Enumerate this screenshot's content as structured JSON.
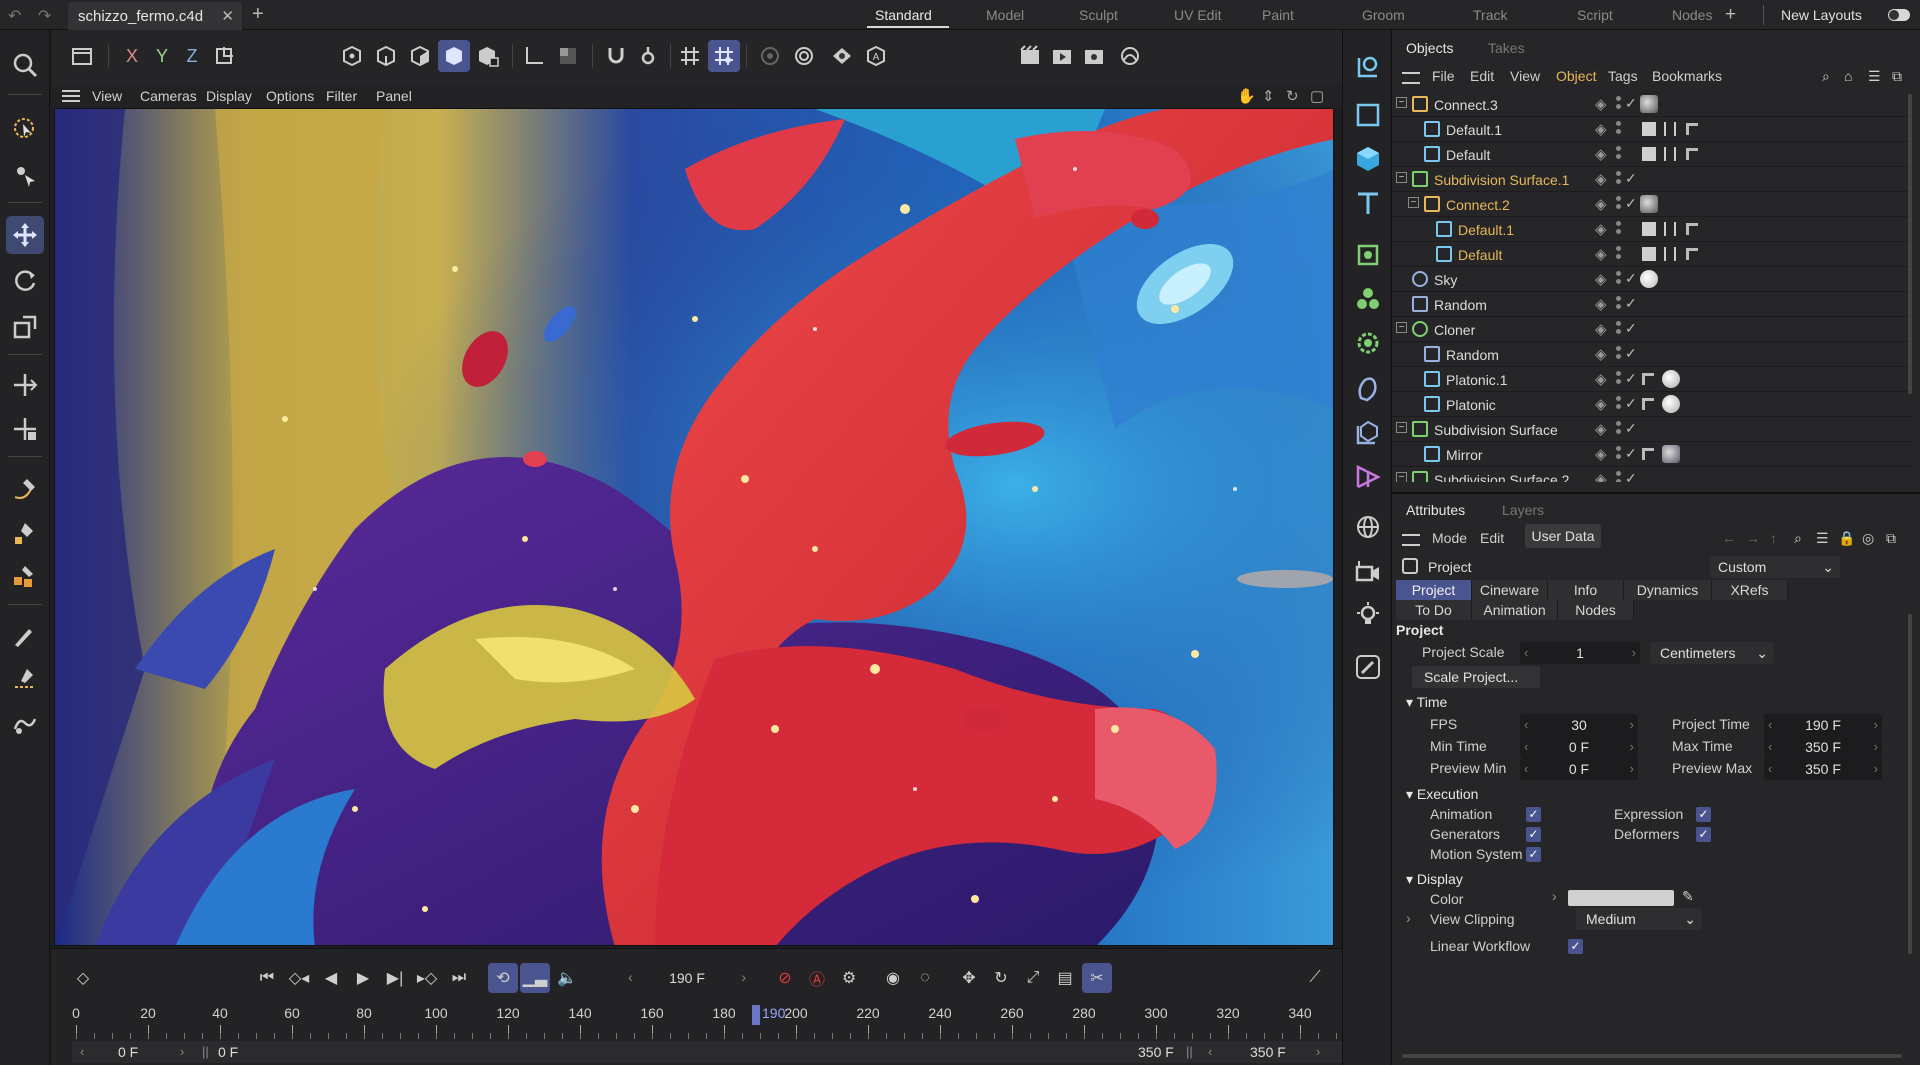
{
  "topbar": {
    "filename": "schizzo_fermo.c4d",
    "layouts": [
      "Standard",
      "Model",
      "Sculpt",
      "UV Edit",
      "Paint",
      "Groom",
      "Track",
      "Script",
      "Nodes"
    ],
    "active_layout": "Standard",
    "new_layouts": "New Layouts"
  },
  "axis": {
    "x": "X",
    "y": "Y",
    "z": "Z"
  },
  "viewport_menu": [
    "View",
    "Cameras",
    "Display",
    "Options",
    "Filter",
    "Panel"
  ],
  "timeline": {
    "current_frame": "190 F",
    "ruler_labels": [
      "0",
      "20",
      "40",
      "60",
      "80",
      "100",
      "120",
      "140",
      "160",
      "180",
      "200",
      "220",
      "240",
      "260",
      "280",
      "300",
      "320",
      "340"
    ],
    "current_marker": "190",
    "range_start": "0 F",
    "range_start2": "0 F",
    "range_end": "350 F",
    "range_end2": "350 F"
  },
  "objects_panel": {
    "tabs": [
      "Objects",
      "Takes"
    ],
    "menu": [
      "File",
      "Edit",
      "View",
      "Object",
      "Tags",
      "Bookmarks"
    ],
    "highlight_menu": "Object",
    "items": [
      {
        "name": "Connect.3",
        "indent": 0,
        "icon": "connect",
        "yellow": false
      },
      {
        "name": "Default.1",
        "indent": 1,
        "icon": "figure",
        "yellow": false
      },
      {
        "name": "Default",
        "indent": 1,
        "icon": "figure",
        "yellow": false
      },
      {
        "name": "Subdivision Surface.1",
        "indent": 0,
        "icon": "subdiv",
        "yellow": true
      },
      {
        "name": "Connect.2",
        "indent": 1,
        "icon": "connect",
        "yellow": true
      },
      {
        "name": "Default.1",
        "indent": 2,
        "icon": "figure",
        "yellow": true
      },
      {
        "name": "Default",
        "indent": 2,
        "icon": "figure",
        "yellow": true
      },
      {
        "name": "Sky",
        "indent": 0,
        "icon": "sky",
        "yellow": false
      },
      {
        "name": "Random",
        "indent": 0,
        "icon": "random",
        "yellow": false
      },
      {
        "name": "Cloner",
        "indent": 0,
        "icon": "cloner",
        "yellow": false
      },
      {
        "name": "Random",
        "indent": 1,
        "icon": "random",
        "yellow": false
      },
      {
        "name": "Platonic.1",
        "indent": 1,
        "icon": "platonic",
        "yellow": false
      },
      {
        "name": "Platonic",
        "indent": 1,
        "icon": "platonic",
        "yellow": false
      },
      {
        "name": "Subdivision Surface",
        "indent": 0,
        "icon": "subdiv",
        "yellow": false
      },
      {
        "name": "Mirror",
        "indent": 1,
        "icon": "mirror",
        "yellow": false
      },
      {
        "name": "Subdivision Surface.2",
        "indent": 0,
        "icon": "subdiv",
        "yellow": false
      }
    ]
  },
  "attributes": {
    "tabs": [
      "Attributes",
      "Layers"
    ],
    "menu": [
      "Mode",
      "Edit"
    ],
    "user_data": "User Data",
    "header": "Project",
    "preset": "Custom",
    "subtabs_row1": [
      "Project",
      "Cineware",
      "Info",
      "Dynamics",
      "XRefs"
    ],
    "subtabs_row2": [
      "To Do",
      "Animation",
      "Nodes"
    ],
    "section_project": "Project",
    "project_scale_label": "Project Scale",
    "project_scale": "1",
    "units": "Centimeters",
    "scale_button": "Scale Project...",
    "section_time": "Time",
    "fps_label": "FPS",
    "fps": "30",
    "project_time_label": "Project Time",
    "project_time": "190 F",
    "min_time_label": "Min Time",
    "min_time": "0 F",
    "max_time_label": "Max Time",
    "max_time": "350 F",
    "preview_min_label": "Preview Min",
    "preview_min": "0 F",
    "preview_max_label": "Preview Max",
    "preview_max": "350 F",
    "section_execution": "Execution",
    "animation": "Animation",
    "expression": "Expression",
    "generators": "Generators",
    "deformers": "Deformers",
    "motion_system": "Motion System",
    "section_display": "Display",
    "color_label": "Color",
    "view_clipping_label": "View Clipping",
    "view_clipping": "Medium",
    "linear_workflow": "Linear Workflow"
  }
}
